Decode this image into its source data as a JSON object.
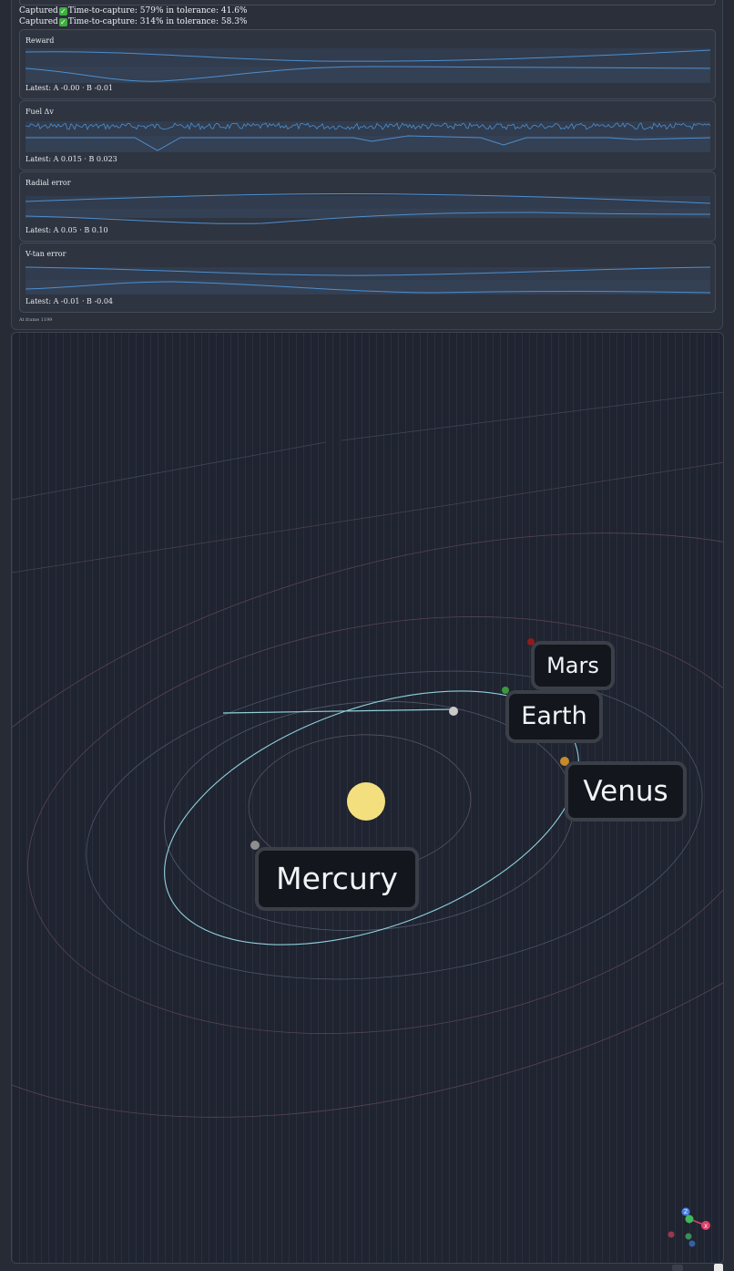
{
  "status_lines": [
    {
      "prefix": "Captured",
      "check": "✓",
      "text": "Time-to-capture: 579% in tolerance: 41.6%"
    },
    {
      "prefix": "Captured",
      "check": "✓",
      "text": "Time-to-capture: 314% in tolerance: 58.3%"
    }
  ],
  "metrics": [
    {
      "title": "Reward",
      "latest": "Latest: A -0.00 · B -0.01"
    },
    {
      "title": "Fuel Δv",
      "latest": "Latest: A 0.015 · B 0.023"
    },
    {
      "title": "Radial error",
      "latest": "Latest: A 0.05 · B 0.10"
    },
    {
      "title": "V-tan error",
      "latest": "Latest: A -0.01 · B -0.04"
    }
  ],
  "frame_note": "At frame 1199",
  "planets": [
    {
      "name": "Mars",
      "color": "#8c1c1c"
    },
    {
      "name": "Earth",
      "color": "#3a9a3a"
    },
    {
      "name": "Venus",
      "color": "#c58a2a"
    },
    {
      "name": "Mercury",
      "color": "#8e8e8e"
    }
  ],
  "sun_color": "#f4df7f",
  "trajectory_color": "#8fd0dc",
  "axis_gizmo": {
    "x_label": "X",
    "z_label": "Z",
    "x_color": "#e0406a",
    "y_color": "#3fb95a",
    "z_color": "#4a7ee0"
  }
}
